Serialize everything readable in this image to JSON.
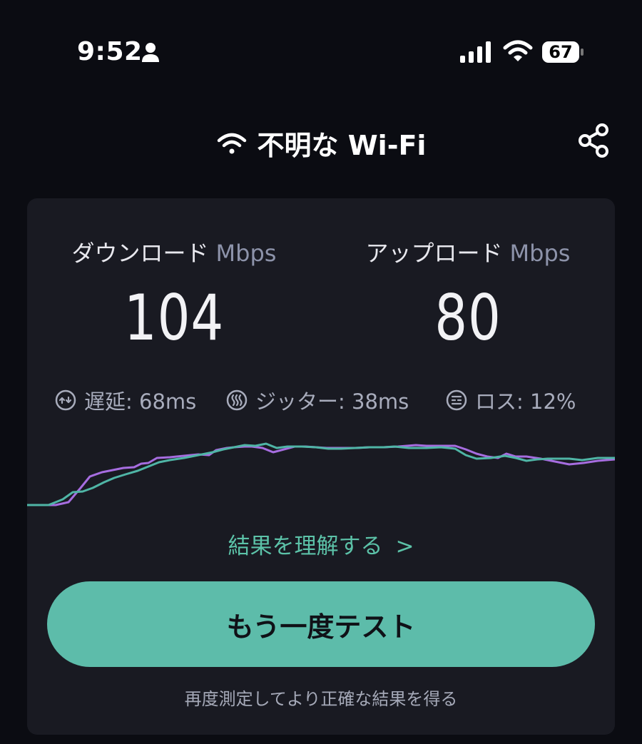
{
  "status_bar": {
    "time": "9:52",
    "battery": "67"
  },
  "header": {
    "network_name": "不明な Wi-Fi"
  },
  "download": {
    "label": "ダウンロード",
    "unit": "Mbps",
    "value": "104"
  },
  "upload": {
    "label": "アップロード",
    "unit": "Mbps",
    "value": "80"
  },
  "metrics": {
    "latency": "遅延: 68ms",
    "jitter": "ジッター: 38ms",
    "loss": "ロス: 12%"
  },
  "links": {
    "understand": "結果を理解する",
    "understand_chevron": ">"
  },
  "actions": {
    "retest_label": "もう一度テスト",
    "hint": "再度測定してより正確な結果を得る"
  },
  "colors": {
    "accent": "#5dbcaa",
    "download_line": "#a66de0",
    "upload_line": "#4fb5a6",
    "card_bg": "#191a22",
    "page_bg": "#0b0c12"
  }
}
